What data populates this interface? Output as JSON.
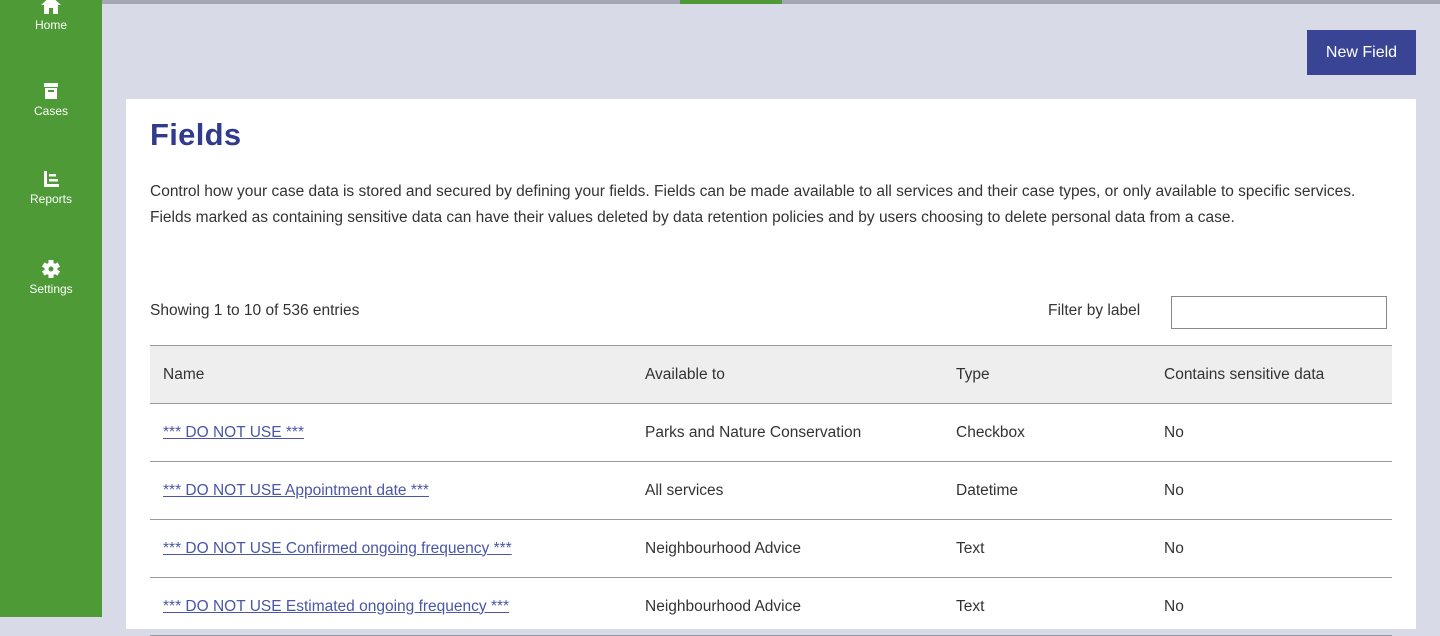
{
  "nav": {
    "items": [
      {
        "label": "Home",
        "icon": "home-icon"
      },
      {
        "label": "Cases",
        "icon": "archive-icon"
      },
      {
        "label": "Reports",
        "icon": "bar-chart-icon"
      },
      {
        "label": "Settings",
        "icon": "gear-icon"
      }
    ]
  },
  "toolbar": {
    "new_field_label": "New Field"
  },
  "page": {
    "title": "Fields",
    "description": "Control how your case data is stored and secured by defining your fields. Fields can be made available to all services and their case types, or only available to specific services. Fields marked as containing sensitive data can have their values deleted by data retention policies and by users choosing to delete personal data from a case."
  },
  "table_info": {
    "showing": "Showing 1 to 10 of 536 entries",
    "filter_label": "Filter by label",
    "filter_value": ""
  },
  "table": {
    "headers": [
      "Name",
      "Available to",
      "Type",
      "Contains sensitive data"
    ],
    "rows": [
      {
        "name": "*** DO NOT USE ***",
        "available_to": "Parks and Nature Conservation",
        "type": "Checkbox",
        "sensitive": "No"
      },
      {
        "name": "*** DO NOT USE Appointment date ***",
        "available_to": "All services",
        "type": "Datetime",
        "sensitive": "No"
      },
      {
        "name": "*** DO NOT USE Confirmed ongoing frequency ***",
        "available_to": "Neighbourhood Advice",
        "type": "Text",
        "sensitive": "No"
      },
      {
        "name": "*** DO NOT USE Estimated ongoing frequency ***",
        "available_to": "Neighbourhood Advice",
        "type": "Text",
        "sensitive": "No"
      }
    ]
  },
  "colors": {
    "sidebar": "#4d9a36",
    "accent": "#3a4495",
    "title": "#313b8e",
    "link": "#4a56a6"
  }
}
